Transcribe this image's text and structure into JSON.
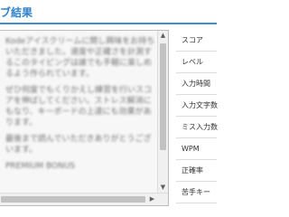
{
  "header": {
    "title": "ブ結果"
  },
  "passage": {
    "paragraphs": [
      "Kodeアイスクリームに関し興味をお持ちいただきました。速度や正確さを計測するこのタイピングは誰でも手軽に楽しめるよう作られています。",
      "ぜひ何度でもくりかえし練習を行いスコアを伸ばしてください。ストレス解消にもなり、キーボードの上達にも効果があります。",
      "最後まで読んでいただきありがとうございます。",
      "PREMIUM BONUS"
    ]
  },
  "stats": {
    "labels": [
      "スコア",
      "レベル",
      "入力時間",
      "入力文字数",
      "ミス入力数",
      "WPM",
      "正確率",
      "苦手キー"
    ]
  },
  "scrollbar": {
    "up_arrow": "▲",
    "down_arrow": "▼",
    "right_arrow": "▶"
  }
}
